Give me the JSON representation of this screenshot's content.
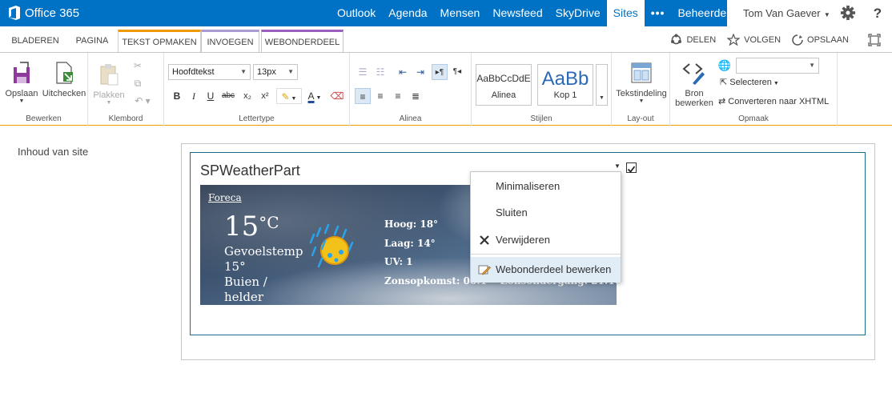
{
  "suite": {
    "brand": "Office 365",
    "nav": [
      "Outlook",
      "Agenda",
      "Mensen",
      "Newsfeed",
      "SkyDrive",
      "Sites",
      "•••",
      "Beheerder"
    ],
    "user": "Tom Van Gaever",
    "help": "?"
  },
  "tabs": {
    "bladeren": "BLADEREN",
    "pagina": "PAGINA",
    "tekst_opmaken": "TEKST OPMAKEN",
    "invoegen": "INVOEGEN",
    "webonderdeel": "WEBONDERDEEL"
  },
  "actions": {
    "share": "DELEN",
    "follow": "VOLGEN",
    "save": "OPSLAAN"
  },
  "ribbon": {
    "bewerken": {
      "opslaan": "Opslaan",
      "uitchecken": "Uitchecken",
      "label": "Bewerken"
    },
    "klembord": {
      "plakken": "Plakken",
      "label": "Klembord"
    },
    "lettertype": {
      "font": "Hoofdtekst",
      "size": "13px",
      "label": "Lettertype"
    },
    "alinea": {
      "label": "Alinea"
    },
    "stijlen": {
      "alinea_sample": "AaBbCcDdE",
      "alinea_name": "Alinea",
      "kop1_sample": "AaBb",
      "kop1_name": "Kop 1",
      "label": "Stijlen"
    },
    "layout": {
      "tekstindeling": "Tekstindeling",
      "label": "Lay-out"
    },
    "opmaak": {
      "bron": "Bron",
      "bewerken": "bewerken",
      "selecteren": "Selecteren",
      "converteren": "Converteren naar XHTML",
      "label": "Opmaak"
    }
  },
  "leftnav": {
    "site_contents": "Inhoud van site"
  },
  "webpart": {
    "title": "SPWeatherPart",
    "weather": {
      "provider": "Foreca",
      "temp": "15",
      "unit": "°C",
      "feels_label": "Gevoelstemp",
      "feels_value": "15°",
      "condition1": "Buien /",
      "condition2": "helder",
      "high": "Hoog: 18°",
      "low": "Laag: 14°",
      "uv": "UV: 1",
      "sunrise": "Zonsopkomst: 06:1",
      "sunset": "Zonsondergang: 21:10"
    }
  },
  "menu": {
    "minimize": "Minimaliseren",
    "close": "Sluiten",
    "delete": "Verwijderen",
    "edit": "Webonderdeel bewerken"
  },
  "colors": {
    "suite_blue": "#0072c6",
    "ribbon_orange": "#f09900",
    "webpart_tab": "#9b5fc0"
  }
}
